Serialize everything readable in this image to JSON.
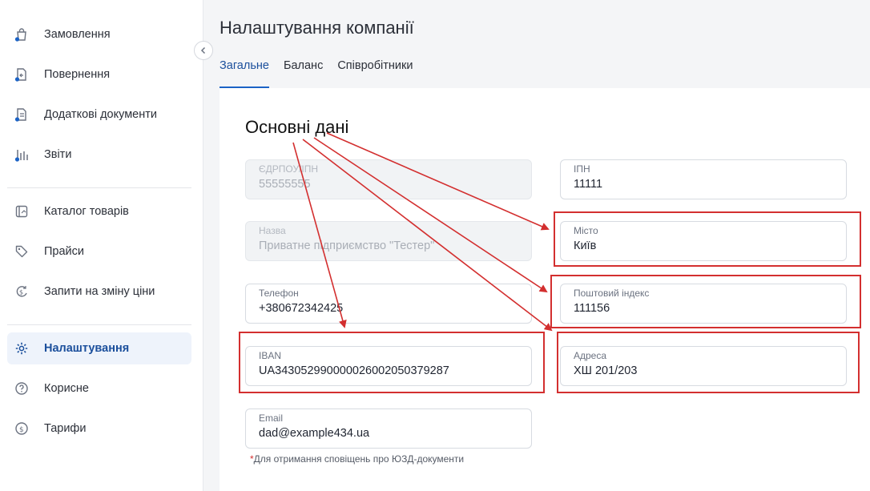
{
  "sidebar": {
    "items": [
      {
        "label": "Замовлення",
        "icon": "bag-icon"
      },
      {
        "label": "Повернення",
        "icon": "return-document-icon"
      },
      {
        "label": "Додаткові документи",
        "icon": "documents-icon"
      },
      {
        "label": "Звіти",
        "icon": "reports-chart-icon"
      },
      {
        "label": "Каталог товарів",
        "icon": "catalog-icon"
      },
      {
        "label": "Прайси",
        "icon": "price-tag-icon"
      },
      {
        "label": "Запити на зміну ціни",
        "icon": "price-change-icon"
      },
      {
        "label": "Налаштування",
        "icon": "gear-icon",
        "active": true
      },
      {
        "label": "Корисне",
        "icon": "help-icon"
      },
      {
        "label": "Тарифи",
        "icon": "coin-icon"
      }
    ]
  },
  "header": {
    "title": "Налаштування компанії",
    "tabs": [
      {
        "label": "Загальне",
        "active": true
      },
      {
        "label": "Баланс"
      },
      {
        "label": "Співробітники"
      }
    ]
  },
  "main": {
    "section_title": "Основні дані",
    "fields": {
      "edrpou": {
        "label": "ЄДРПОУ/ІПН",
        "value": "55555555",
        "disabled": true
      },
      "ipn": {
        "label": "ІПН",
        "value": "11111"
      },
      "name": {
        "label": "Назва",
        "value": "Приватне підприємство \"Тестер\"",
        "disabled": true
      },
      "city": {
        "label": "Місто",
        "value": "Київ"
      },
      "phone": {
        "label": "Телефон",
        "value": "+380672342425"
      },
      "postal": {
        "label": "Поштовий індекс",
        "value": "111156"
      },
      "iban": {
        "label": "IBAN",
        "value": "UA343052990000026002050379287"
      },
      "address": {
        "label": "Адреса",
        "value": "ХШ 201/203"
      },
      "email": {
        "label": "Email",
        "value": "dad@example434.ua"
      }
    },
    "note_star": "*",
    "note": "Для отримання сповіщень про ЮЗД-документи"
  },
  "colors": {
    "accent": "#1b63c6",
    "active_text": "#1b4f9c",
    "annotation": "#d32f2f",
    "notification_dot": "#1b63c6"
  }
}
